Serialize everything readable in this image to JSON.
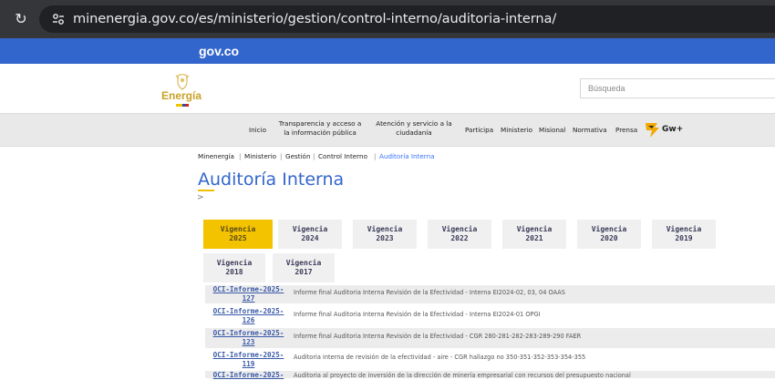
{
  "browser": {
    "url": "minenergia.gov.co/es/ministerio/gestion/control-interno/auditoria-interna/"
  },
  "gov_bar": {
    "logo": "gov.co"
  },
  "header": {
    "logo_text": "Energía",
    "search_placeholder": "Búsqueda"
  },
  "nav": {
    "items": [
      {
        "label": "Inicio"
      },
      {
        "label": "Transparencia y acceso a\nla información pública"
      },
      {
        "label": "Atención y servicio a la\nciudadanía"
      },
      {
        "label": "Participa"
      },
      {
        "label": "Ministerio"
      },
      {
        "label": "Misional"
      },
      {
        "label": "Normativa"
      },
      {
        "label": "Prensa"
      }
    ],
    "badge_text": "Gw+"
  },
  "breadcrumb": {
    "items": [
      "Minenergía",
      "Ministerio",
      "Gestión",
      "Control Interno",
      "Auditoría Interna"
    ],
    "separator": "|"
  },
  "page": {
    "title": "Auditoría Interna",
    "chevron": ">"
  },
  "tabs": [
    {
      "label": "Vigencia\n2025",
      "active": true
    },
    {
      "label": "Vigencia\n2024"
    },
    {
      "label": "Vigencia\n2023"
    },
    {
      "label": "Vigencia\n2022"
    },
    {
      "label": "Vigencia\n2021"
    },
    {
      "label": "Vigencia\n2020"
    },
    {
      "label": "Vigencia\n2019"
    },
    {
      "label": "Vigencia\n2018"
    },
    {
      "label": "Vigencia\n2017"
    }
  ],
  "reports": [
    {
      "id": "OCI-Informe-2025-\n127",
      "desc": "Informe final Auditoria Interna Revisión de la Efectividad - Interna EI2024-02, 03, 04 OAAS"
    },
    {
      "id": "OCI-Informe-2025-\n126",
      "desc": "Informe final Auditoria Interna Revisión de la Efectividad - Interna EI2024-01 OPGI"
    },
    {
      "id": "OCI-Informe-2025-\n123",
      "desc": "Informe final Auditoria Interna Revisión de la Efectividad - CGR 280-281-282-283-289-290 FAER"
    },
    {
      "id": "OCI-Informe-2025-\n119",
      "desc": "Auditoria interna de revisión de la efectividad - aire - CGR hallazgo no 350-351-352-353-354-355"
    },
    {
      "id": "OCI-Informe-2025-",
      "desc": "Auditoria al proyecto de inversión de la dirección de minería empresarial con recursos del presupuesto nacional"
    }
  ],
  "colors": {
    "gov_blue": "#3366cc",
    "tab_active": "#f3c300",
    "title_blue": "#3366cc",
    "link_blue": "#3a5aa8"
  }
}
